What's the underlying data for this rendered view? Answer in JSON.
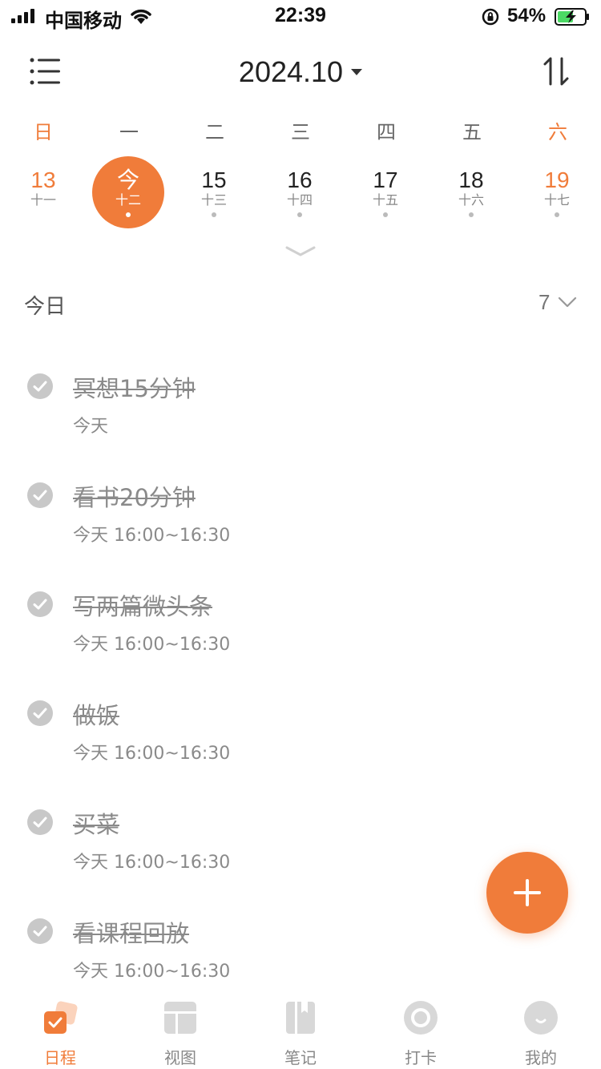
{
  "status_bar": {
    "carrier": "中国移动",
    "time": "22:39",
    "battery_percent": "54%"
  },
  "header": {
    "month": "2024.10"
  },
  "weekdays": [
    "日",
    "一",
    "二",
    "三",
    "四",
    "五",
    "六"
  ],
  "dates": [
    {
      "num": "13",
      "lunar": "十一",
      "has_event": false
    },
    {
      "num": "今",
      "lunar": "十二",
      "has_event": true
    },
    {
      "num": "15",
      "lunar": "十三",
      "has_event": true
    },
    {
      "num": "16",
      "lunar": "十四",
      "has_event": true
    },
    {
      "num": "17",
      "lunar": "十五",
      "has_event": true
    },
    {
      "num": "18",
      "lunar": "十六",
      "has_event": true
    },
    {
      "num": "19",
      "lunar": "十七",
      "has_event": true
    }
  ],
  "section": {
    "title": "今日",
    "count": "7"
  },
  "tasks": [
    {
      "title": "冥想15分钟",
      "sub": "今天",
      "done": true
    },
    {
      "title": "看书20分钟",
      "sub": "今天 16:00~16:30",
      "done": true
    },
    {
      "title": "写两篇微头条",
      "sub": "今天 16:00~16:30",
      "done": true
    },
    {
      "title": "做饭",
      "sub": "今天 16:00~16:30",
      "done": true
    },
    {
      "title": "买菜",
      "sub": "今天 16:00~16:30",
      "done": true
    },
    {
      "title": "看课程回放",
      "sub": "今天 16:00~16:30",
      "done": true
    }
  ],
  "tabbar": [
    {
      "label": "日程",
      "icon": "schedule-icon",
      "active": true
    },
    {
      "label": "视图",
      "icon": "view-icon",
      "active": false
    },
    {
      "label": "笔记",
      "icon": "notebook-icon",
      "active": false
    },
    {
      "label": "打卡",
      "icon": "checkin-icon",
      "active": false
    },
    {
      "label": "我的",
      "icon": "profile-icon",
      "active": false
    }
  ],
  "colors": {
    "accent": "#f07c3a",
    "done_text": "#8a8a8a",
    "check_circle": "#c8c8c8"
  }
}
